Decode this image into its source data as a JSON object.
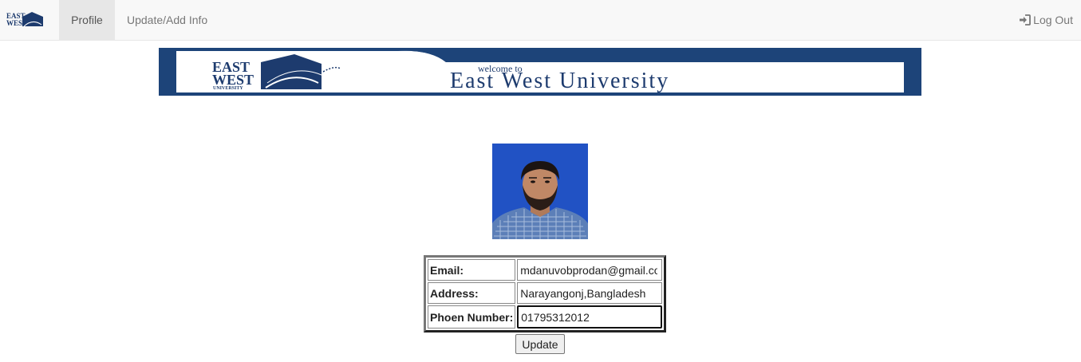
{
  "navbar": {
    "brand_logo": "east-west-university-logo",
    "items": [
      {
        "label": "Profile",
        "active": true
      },
      {
        "label": "Update/Add Info",
        "active": false
      }
    ],
    "logout": {
      "label": "Log Out",
      "icon": "log-in-icon"
    }
  },
  "banner": {
    "welcome": "welcome to",
    "title": "East West University",
    "logo_line1": "EAST",
    "logo_line2": "WEST",
    "logo_line3": "UNIVERSITY"
  },
  "profile": {
    "photo": "profile-photo"
  },
  "form": {
    "rows": [
      {
        "label": "Email:",
        "value": "mdanuvobprodan@gmail.com"
      },
      {
        "label": "Address:",
        "value": "Narayangonj,Bangladesh"
      },
      {
        "label": "Phoen Number:",
        "value": "01795312012"
      }
    ],
    "submit_label": "Update"
  },
  "colors": {
    "navbar_bg": "#f8f8f8",
    "active_tab_bg": "#e7e7e7",
    "banner_navy": "#1d4479",
    "photo_bg": "#2152c4"
  }
}
